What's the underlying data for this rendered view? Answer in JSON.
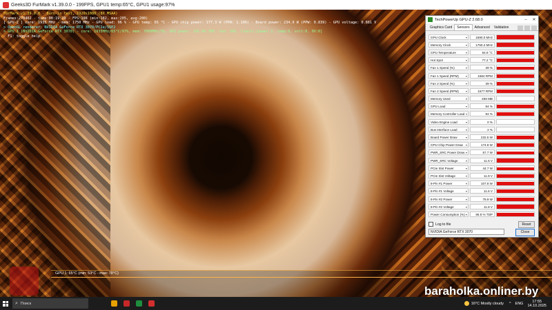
{
  "furmark": {
    "window_title": "Geeks3D FurMark v1.39.0.0 - 199FPS, GPU1 temp:65°C, GPU1 usage:97%",
    "osd": [
      {
        "text": "FurMark v1.39.0.0 - Burn-in test, 1920x1080 (8X MSAA)",
        "color": "yellow"
      },
      {
        "text": "Frames:278402 - time:00:19:29 - FPS:198 (min:182, max:205, avg:200)",
        "color": "white"
      },
      {
        "text": "[ GPU-Z ] core: 1935 MHz - mem: 1750 MHz - GPU load: 96 % - GPU temp: 65 °C - GPU chip power: 177.3 W (PPW: 1.106) - Board power: 234.9 W (PPW: 0.839) - GPU voltage: 0.881 V",
        "color": "white"
      },
      {
        "text": "> OpenGL renderer: NVIDIA GeForce RTX 3070/PCIe/SSE2",
        "color": "cyan"
      },
      {
        "text": "> GPU 1 (NVIDIA GeForce RTX 3070) - core: 1935MHz/65°C/97%, mem: 7000MHz/5%, GPU power: 101.0% TDP, fan: 39%, limits:[power:1, temp:0, volt:0, OV:0]",
        "color": "green"
      },
      {
        "text": "- F1: toggle help",
        "color": "white"
      }
    ],
    "graph_label": "GPU 1: 65°C (min: 53°C - max: 78°C)"
  },
  "gpuz": {
    "window_title": "TechPowerUp GPU-Z 2.68.0",
    "tabs": [
      {
        "label": "Graphics Card",
        "active": false
      },
      {
        "label": "Sensors",
        "active": true
      },
      {
        "label": "Advanced",
        "active": false
      },
      {
        "label": "Validation",
        "active": false
      }
    ],
    "sensors": [
      {
        "name": "GPU Clock",
        "value": "1590.0 MHz",
        "level": 0.9
      },
      {
        "name": "Memory Clock",
        "value": "1750.2 MHz",
        "level": 0.92
      },
      {
        "name": "GPU Temperature",
        "value": "64.8 °C",
        "level": 0.85
      },
      {
        "name": "Hot Spot",
        "value": "77.2 °C",
        "level": 0.88
      },
      {
        "name": "Fan 1 Speed (%)",
        "value": "39 %",
        "level": 0.75
      },
      {
        "name": "Fan 1 Speed (RPM)",
        "value": "1584 RPM",
        "level": 0.75
      },
      {
        "name": "Fan 2 Speed (%)",
        "value": "39 %",
        "level": 0.75
      },
      {
        "name": "Fan 2 Speed (RPM)",
        "value": "1577 RPM",
        "level": 0.75
      },
      {
        "name": "Memory Used",
        "value": "459 MB",
        "level": 0.0
      },
      {
        "name": "GPU Load",
        "value": "94 %",
        "level": 0.9
      },
      {
        "name": "Memory Controller Load",
        "value": "94 %",
        "level": 0.85
      },
      {
        "name": "Video Engine Load",
        "value": "0 %",
        "level": 0.0
      },
      {
        "name": "Bus Interface Load",
        "value": "2 %",
        "level": 0.05
      },
      {
        "name": "Board Power Draw",
        "value": "232.5 W",
        "level": 0.88
      },
      {
        "name": "GPU Chip Power Draw",
        "value": "174.8 W",
        "level": 0.85
      },
      {
        "name": "PWR_SRC Power Draw",
        "value": "57.7 W",
        "level": 0.7
      },
      {
        "name": "PWR_SRC Voltage",
        "value": "11.6 V",
        "level": 0.9
      },
      {
        "name": "PCIe Slot Power",
        "value": "44.7 W",
        "level": 0.65
      },
      {
        "name": "PCIe Slot Voltage",
        "value": "11.9 V",
        "level": 0.9
      },
      {
        "name": "8-Pin #1 Power",
        "value": "107.8 W",
        "level": 0.85
      },
      {
        "name": "8-Pin #1 Voltage",
        "value": "11.6 V",
        "level": 0.9
      },
      {
        "name": "8-Pin #2 Power",
        "value": "79.9 W",
        "level": 0.8
      },
      {
        "name": "8-Pin #2 Voltage",
        "value": "11.8 V",
        "level": 0.9
      },
      {
        "name": "Power Consumption (%)",
        "value": "96.9 % TDP",
        "level": 0.88
      }
    ],
    "log_label": "Log to file",
    "reset_label": "Reset",
    "gpu_select": "NVIDIA GeForce RTX 3070",
    "close_label": "Close"
  },
  "taskbar": {
    "search_placeholder": "Поиск",
    "weather": "16°C Mostly cloudy",
    "lang": "ENG",
    "time": "17:55",
    "date": "14.10.2025",
    "app_colors": [
      "#e5a100",
      "#c62828",
      "#1e8e3e",
      "#d32f2f"
    ]
  },
  "watermark": "baraholka.onliner.by"
}
